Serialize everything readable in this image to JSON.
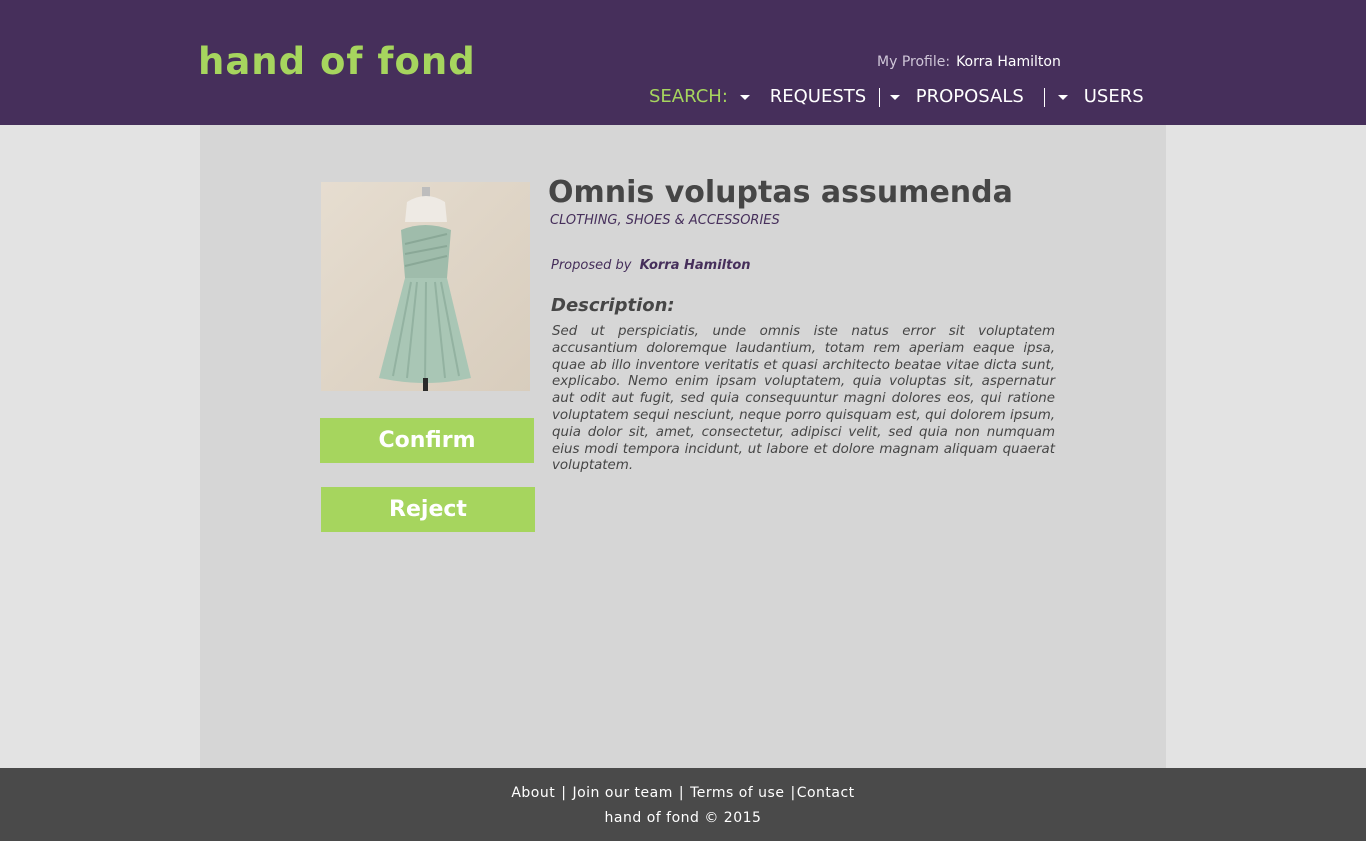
{
  "header": {
    "logo": "hand of fond",
    "profile_label": "My Profile:",
    "profile_name": "Korra Hamilton",
    "nav": {
      "search": "SEARCH:",
      "requests": "REQUESTS",
      "proposals": "PROPOSALS",
      "users": "USERS"
    }
  },
  "item": {
    "title": "Omnis voluptas assumenda",
    "category": "CLOTHING, SHOES & ACCESSORIES",
    "proposed_label": "Proposed by",
    "proposed_by": "Korra Hamilton",
    "description_heading": "Description:",
    "description": "Sed ut perspiciatis, unde omnis iste natus error sit voluptatem accusantium doloremque laudantium, totam rem aperiam eaque ipsa, quae ab illo inventore veritatis et quasi architecto beatae vitae dicta sunt, explicabo. Nemo enim ipsam voluptatem, quia voluptas sit, aspernatur aut odit aut fugit, sed quia consequuntur magni dolores eos, qui ratione voluptatem sequi nesciunt, neque porro quisquam est, qui dolorem ipsum, quia dolor sit, amet, consectetur, adipisci velit, sed quia non numquam eius modi tempora incidunt, ut labore et dolore magnam aliquam quaerat voluptatem."
  },
  "actions": {
    "confirm": "Confirm",
    "reject": "Reject"
  },
  "footer": {
    "about": "About",
    "join": "Join our team",
    "terms": "Terms of use",
    "contact": "Contact",
    "copyright": "hand of fond © 2015"
  },
  "colors": {
    "header_bg": "#462f5b",
    "accent": "#a6d55e",
    "footer_bg": "#4a4a4a"
  },
  "icons": [
    "caret-down-icon",
    "dress-image"
  ]
}
